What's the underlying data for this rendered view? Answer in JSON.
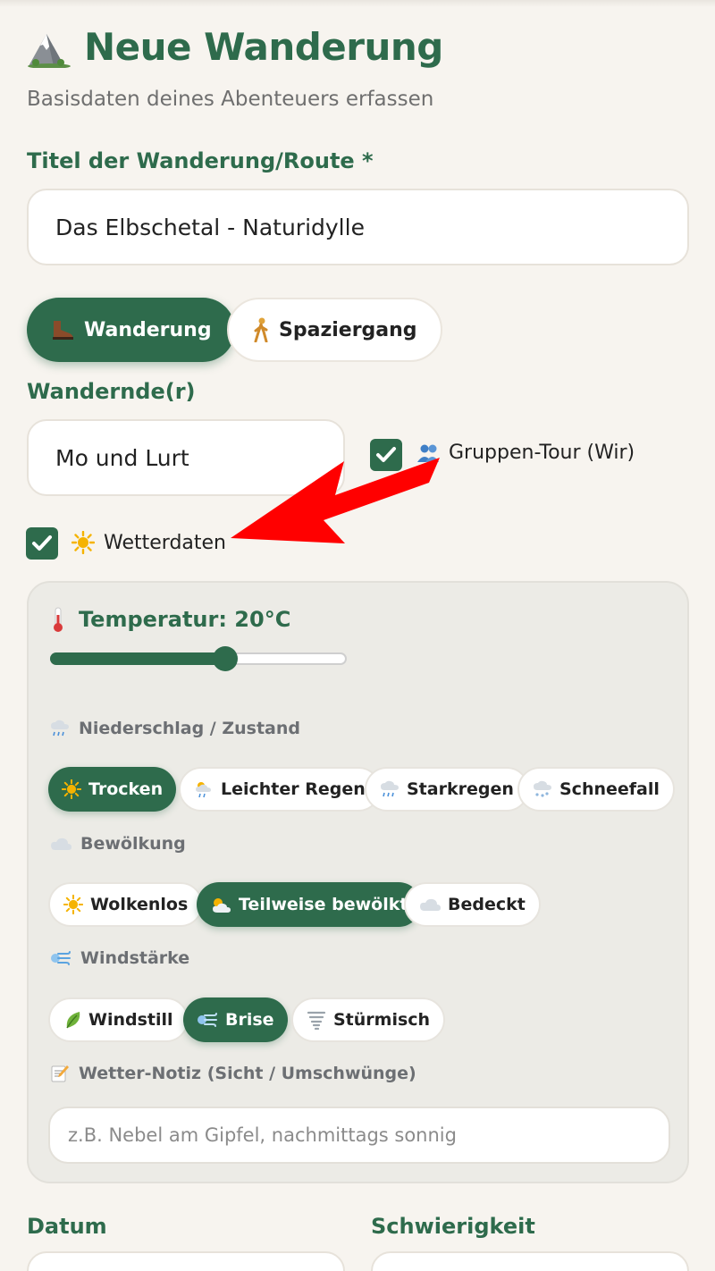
{
  "header": {
    "title": "Neue Wanderung",
    "subtitle": "Basisdaten deines Abenteuers erfassen",
    "icon": "mountain-icon"
  },
  "route": {
    "label": "Titel der Wanderung/Route *",
    "value": "Das Elbschetal - Naturidylle"
  },
  "type_toggle": {
    "options": [
      {
        "label": "Wanderung",
        "icon": "hiking-boot-icon",
        "active": true
      },
      {
        "label": "Spaziergang",
        "icon": "walking-person-icon",
        "active": false
      }
    ]
  },
  "hikers": {
    "label": "Wandernde(r)",
    "value": "Mo und Lurt",
    "group_label": "Gruppen-Tour (Wir)",
    "group_checked": true
  },
  "weather": {
    "toggle_label": "Wetterdaten",
    "enabled": true,
    "temperature_label": "Temperatur: 20°C",
    "temperature_fraction": 0.59,
    "precipitation": {
      "label": "Niederschlag / Zustand",
      "options": [
        {
          "label": "Trocken",
          "icon": "sun-icon",
          "active": true
        },
        {
          "label": "Leichter Regen",
          "icon": "sun-rain-icon",
          "active": false
        },
        {
          "label": "Starkregen",
          "icon": "rain-cloud-icon",
          "active": false
        },
        {
          "label": "Schneefall",
          "icon": "snow-cloud-icon",
          "active": false
        }
      ]
    },
    "clouds": {
      "label": "Bewölkung",
      "options": [
        {
          "label": "Wolkenlos",
          "icon": "sun-icon",
          "active": false
        },
        {
          "label": "Teilweise bewölkt",
          "icon": "sun-cloud-icon",
          "active": true
        },
        {
          "label": "Bedeckt",
          "icon": "cloud-icon",
          "active": false
        }
      ]
    },
    "wind": {
      "label": "Windstärke",
      "options": [
        {
          "label": "Windstill",
          "icon": "leaf-icon",
          "active": false
        },
        {
          "label": "Brise",
          "icon": "wind-icon",
          "active": true
        },
        {
          "label": "Stürmisch",
          "icon": "tornado-icon",
          "active": false
        }
      ]
    },
    "note": {
      "label": "Wetter-Notiz (Sicht / Umschwünge)",
      "placeholder": "z.B. Nebel am Gipfel, nachmittags sonnig"
    }
  },
  "footer_fields": {
    "date_label": "Datum",
    "difficulty_label": "Schwierigkeit"
  },
  "colors": {
    "accent": "#2e6b4c",
    "background": "#f7f4ef",
    "annotation_arrow": "#ff0000"
  }
}
